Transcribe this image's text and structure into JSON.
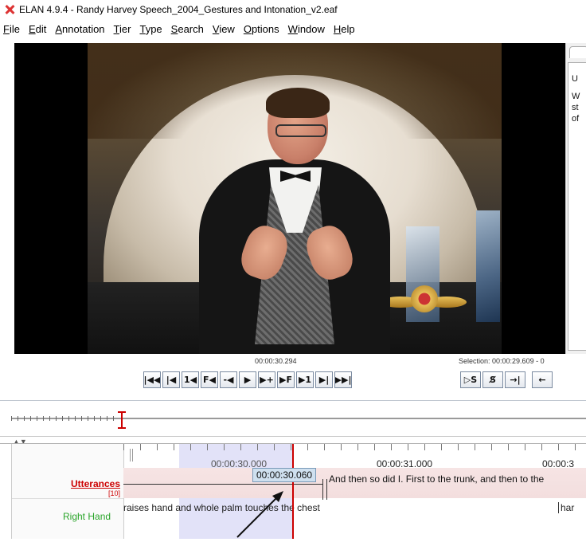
{
  "window": {
    "title": "ELAN 4.9.4 - Randy Harvey Speech_2004_Gestures and Intonation_v2.eaf"
  },
  "menu": [
    "File",
    "Edit",
    "Annotation",
    "Tier",
    "Type",
    "Search",
    "View",
    "Options",
    "Window",
    "Help"
  ],
  "right_panel": {
    "lines": [
      "U",
      "W",
      "st",
      "of"
    ]
  },
  "player": {
    "current_time": "00:00:30.294",
    "selection": "Selection: 00:00:29.609 - 0",
    "buttons": [
      "|◀◀",
      "|◀",
      "1◀",
      "F◀",
      "-◀",
      "▶",
      "▶+",
      "▶F",
      "▶1",
      "▶|",
      "▶▶|"
    ],
    "selection_buttons": [
      "▷S",
      "S̸",
      "→|",
      "←"
    ]
  },
  "timeline": {
    "ruler_labels": [
      "00:00:30.000",
      "00:00:31.000",
      "00:00:3"
    ],
    "tiers": [
      {
        "name": "Utterances",
        "count": "[10]"
      },
      {
        "name": "Right Hand"
      }
    ],
    "cursor_popup": "00:00:30.060",
    "utterance_text": "And then so did I. First to the trunk, and then to the",
    "right_hand_text": "raises hand and whole palm touches the chest",
    "right_hand_text_2": "har"
  },
  "colors": {
    "tier_active": "#cc0000",
    "tier_righthand": "#2aa52a",
    "selection": "#bebef0",
    "cursor": "#cc0000"
  }
}
